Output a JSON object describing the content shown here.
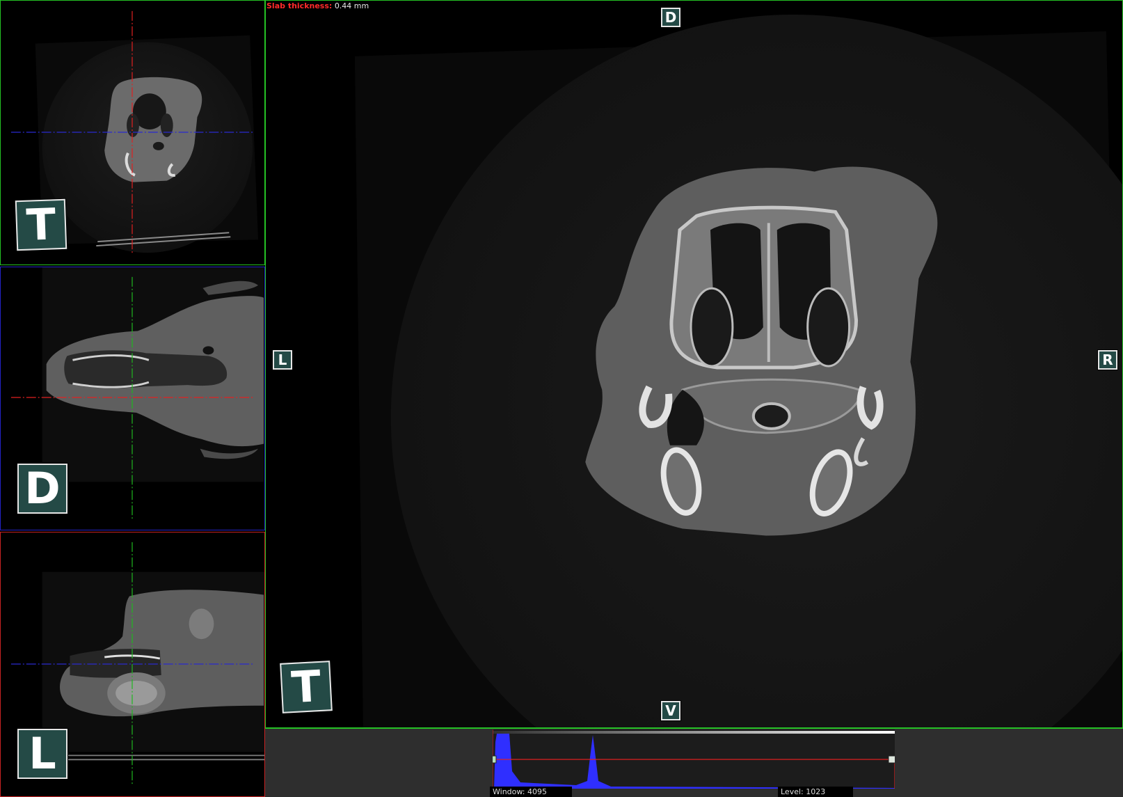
{
  "slab": {
    "label": "Slab thickness:",
    "value": "0.44 mm"
  },
  "views": {
    "axial_small": {
      "marker": "T"
    },
    "dorsal_small": {
      "marker": "D"
    },
    "lateral_small": {
      "marker": "L"
    },
    "main": {
      "orient_top": "D",
      "orient_bottom": "V",
      "orient_left": "L",
      "orient_right": "R",
      "marker": "T"
    }
  },
  "window_level": {
    "window_label": "Window:",
    "window_value": "4095",
    "level_label": "Level:",
    "level_value": "1023"
  },
  "colors": {
    "axial_border": "#25c225",
    "dorsal_border": "#2323c8",
    "lateral_border": "#c82323",
    "histogram_fill": "#2f2fff"
  }
}
